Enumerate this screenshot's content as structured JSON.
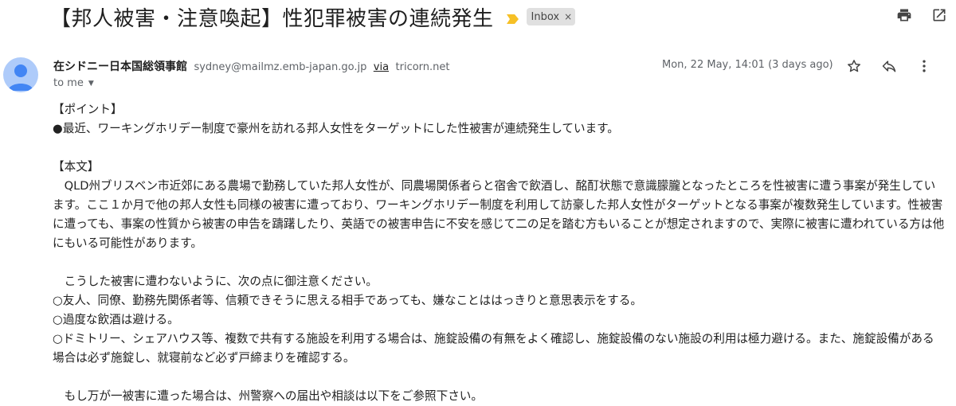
{
  "subject": "【邦人被害・注意喚起】性犯罪被害の連続発生",
  "label": "Inbox",
  "label_remove": "×",
  "icons": {
    "print": "print-icon",
    "open_new_window": "open-in-new-window-icon",
    "star": "star-icon",
    "reply": "reply-icon",
    "more": "more-vert-icon",
    "importance": "importance-marker-icon",
    "avatar": "avatar-icon"
  },
  "colors": {
    "importance": "#f6c026",
    "avatar_bg": "#aecbfa",
    "avatar_fg": "#4285f4"
  },
  "sender": {
    "name": "在シドニー日本国総領事館",
    "email": "sydney@mailmz.emb-japan.go.jp",
    "via_label": "via",
    "relay": "tricorn.net"
  },
  "recipient_label": "to me",
  "date": "Mon, 22 May, 14:01 (3 days ago)",
  "body": {
    "point_heading": "【ポイント】",
    "point_1": "●最近、ワーキングホリデー制度で豪州を訪れる邦人女性をターゲットにした性被害が連続発生しています。",
    "main_heading": "【本文】",
    "main_para": "　QLD州ブリスベン市近郊にある農場で勤務していた邦人女性が、同農場関係者らと宿舎で飲酒し、酩酊状態で意識朦朧となったところを性被害に遭う事案が発生しています。ここ１か月で他の邦人女性も同様の被害に遭っており、ワーキングホリデー制度を利用して訪豪した邦人女性がターゲットとなる事案が複数発生しています。性被害に遭っても、事案の性質から被害の申告を躊躇したり、英語での被害申告に不安を感じて二の足を踏む方もいることが想定されますので、実際に被害に遭われている方は他にもいる可能性があります。",
    "caution_intro": "　こうした被害に遭わないように、次の点に御注意ください。",
    "caution_1": "○友人、同僚、勤務先関係者等、信頼できそうに思える相手であっても、嫌なことははっきりと意思表示をする。",
    "caution_2": "○過度な飲酒は避ける。",
    "caution_3": "○ドミトリー、シェアハウス等、複数で共有する施設を利用する場合は、施錠設備の有無をよく確認し、施錠設備のない施設の利用は極力避ける。また、施錠設備がある場合は必ず施錠し、就寝前など必ず戸締まりを確認する。",
    "closing": "　もし万が一被害に遭った場合は、州警察への届出や相談は以下をご参照下さい。"
  }
}
